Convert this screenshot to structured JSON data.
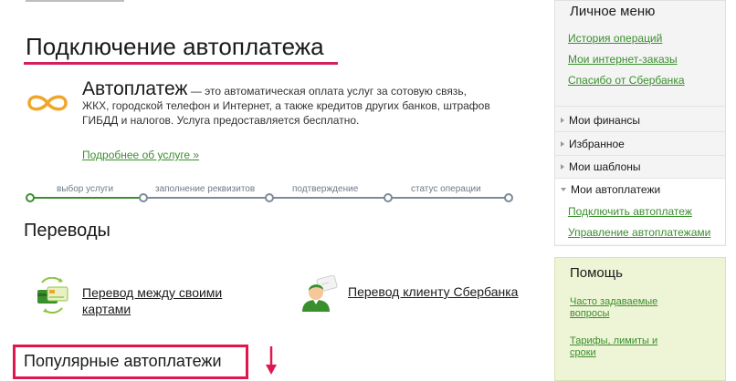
{
  "page": {
    "title": "Подключение автоплатежа"
  },
  "autopay": {
    "term": "Автоплатеж",
    "description": " — это автоматическая оплата услуг за сотовую связь, ЖКХ, городской телефон и Интернет, а также кредитов других банков, штрафов ГИБДД и налогов. Услуга предоставляется бесплатно.",
    "more_link": "Подробнее об услуге »"
  },
  "steps": [
    {
      "label": "выбор услуги",
      "state": "done"
    },
    {
      "label": "заполнение реквизитов",
      "state": "pending"
    },
    {
      "label": "подтверждение",
      "state": "pending"
    },
    {
      "label": "статус операции",
      "state": "pending"
    }
  ],
  "transfers": {
    "title": "Переводы",
    "own_accounts": "Перевод между своими картами",
    "to_client": "Перевод клиенту Сбербанка"
  },
  "popular": {
    "title": "Популярные автоплатежи"
  },
  "sidebar": {
    "personal_menu": {
      "title": "Личное меню",
      "links": [
        "История операций",
        "Мои интернет-заказы",
        "Спасибо от Сбербанка"
      ]
    },
    "sections": [
      "Мои финансы",
      "Избранное",
      "Мои шаблоны",
      "Мои автоплатежи"
    ],
    "autopay_links": [
      "Подключить автоплатеж",
      "Управление автоплатежами"
    ]
  },
  "help": {
    "title": "Помощь",
    "links": [
      "Часто задаваемые вопросы",
      "Тарифы, лимиты и сроки"
    ]
  },
  "colors": {
    "accent_green": "#3a8f2d",
    "title_underline": "#d2205b",
    "highlight_red": "#e0174f",
    "autopay_icon": "#f0a62a",
    "help_bg": "#eef4d6"
  },
  "icons": {
    "autopay": "infinity-icon",
    "own_transfer": "cards-exchange-icon",
    "client_transfer": "person-icon",
    "arrow": "arrow-down-icon"
  }
}
